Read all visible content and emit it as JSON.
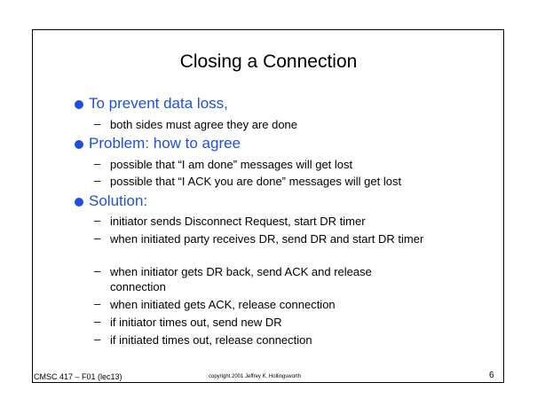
{
  "slide": {
    "title": "Closing a Connection",
    "sections": [
      {
        "heading": "To prevent data loss,",
        "items": [
          "both sides must agree they are done"
        ]
      },
      {
        "heading": "Problem: how to agree",
        "items": [
          "possible that “I am done” messages will get lost",
          "possible that “I ACK you are done” messages will get lost"
        ]
      },
      {
        "heading": "Solution:",
        "items": [
          "initiator sends Disconnect Request, start DR timer",
          "when initiated party receives DR, send DR and start DR timer",
          "when initiator gets DR back, send ACK and release connection",
          "when initiated gets ACK, release connection",
          "if initiator times out, send new DR",
          "if initiated times out, release connection"
        ]
      }
    ],
    "dash_glyph": "–"
  },
  "footer": {
    "course": "CMSC 417 – F01  (lec13)",
    "copyright": "copyright 2001 Jeffrey K. Hollingsworth",
    "page_number": "6"
  },
  "colors": {
    "accent": "#1f4fe0",
    "text": "#000000",
    "background": "#ffffff"
  }
}
